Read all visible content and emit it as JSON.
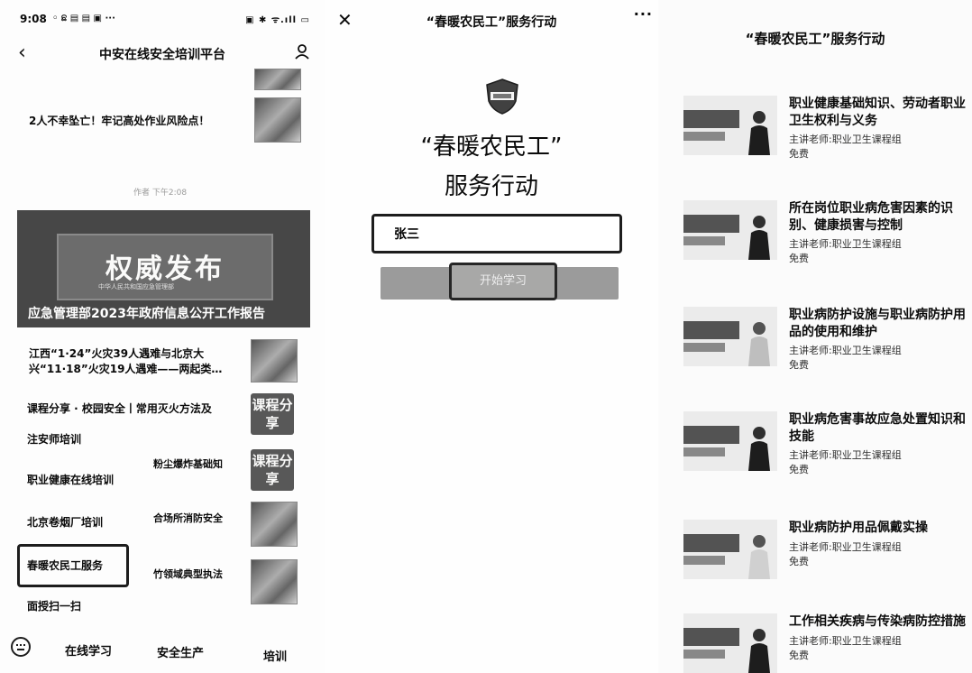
{
  "panel1": {
    "status": {
      "time": "9:08",
      "icons_left": "◦ ଛ ▤ ▤ ▣ ···",
      "icons_right": "▣ ✱ ᯤ.ıll ▭"
    },
    "header": {
      "title": "中安在线安全培训平台"
    },
    "news": [
      {
        "title": "2人不幸坠亡！牢记高处作业风险点！"
      }
    ],
    "note": "作者 下午2:08",
    "banner": {
      "big": "权威发布",
      "sub": "中华人民共和国应急管理部",
      "caption": "应急管理部2023年政府信息公开工作报告"
    },
    "news2": {
      "title": "江西“1·24”火灾39人遇难与北京大兴“11·18”火灾19人遇难——两起类…"
    },
    "course_share": {
      "title": "课程分享 · 校园安全丨常用灭火方法及",
      "thumb": "课程分享"
    },
    "menu_left": [
      "注安师培训",
      "职业健康在线培训",
      "北京卷烟厂培训",
      "春暖农民工服务",
      "面授扫一扫"
    ],
    "menu_right": [
      "粉尘爆炸基础知",
      "合场所消防安全",
      "竹领域典型执法"
    ],
    "thumb2": "课程分享",
    "tabs": [
      "在线学习",
      "安全生产",
      "培训"
    ]
  },
  "panel2": {
    "title": "“春暖农民工”服务行动",
    "more": "···",
    "heading1": "“春暖农民工”",
    "heading2": "服务行动",
    "name_value": "张三",
    "start_button": "开始学习"
  },
  "panel3": {
    "title": "“春暖农民工”服务行动",
    "courses": [
      {
        "title": "职业健康基础知识、劳动者职业卫生权利与义务",
        "teacher": "主讲老师:职业卫生课程组",
        "price": "免费"
      },
      {
        "title": "所在岗位职业病危害因素的识别、健康损害与控制",
        "teacher": "主讲老师:职业卫生课程组",
        "price": "免费"
      },
      {
        "title": "职业病防护设施与职业病防护用品的使用和维护",
        "teacher": "主讲老师:职业卫生课程组",
        "price": "免费"
      },
      {
        "title": "职业病危害事故应急处置知识和技能",
        "teacher": "主讲老师:职业卫生课程组",
        "price": "免费"
      },
      {
        "title": "职业病防护用品佩戴实操",
        "teacher": "主讲老师:职业卫生课程组",
        "price": "免费"
      },
      {
        "title": "工作相关疾病与传染病防控措施",
        "teacher": "主讲老师:职业卫生课程组",
        "price": "免费"
      }
    ]
  }
}
